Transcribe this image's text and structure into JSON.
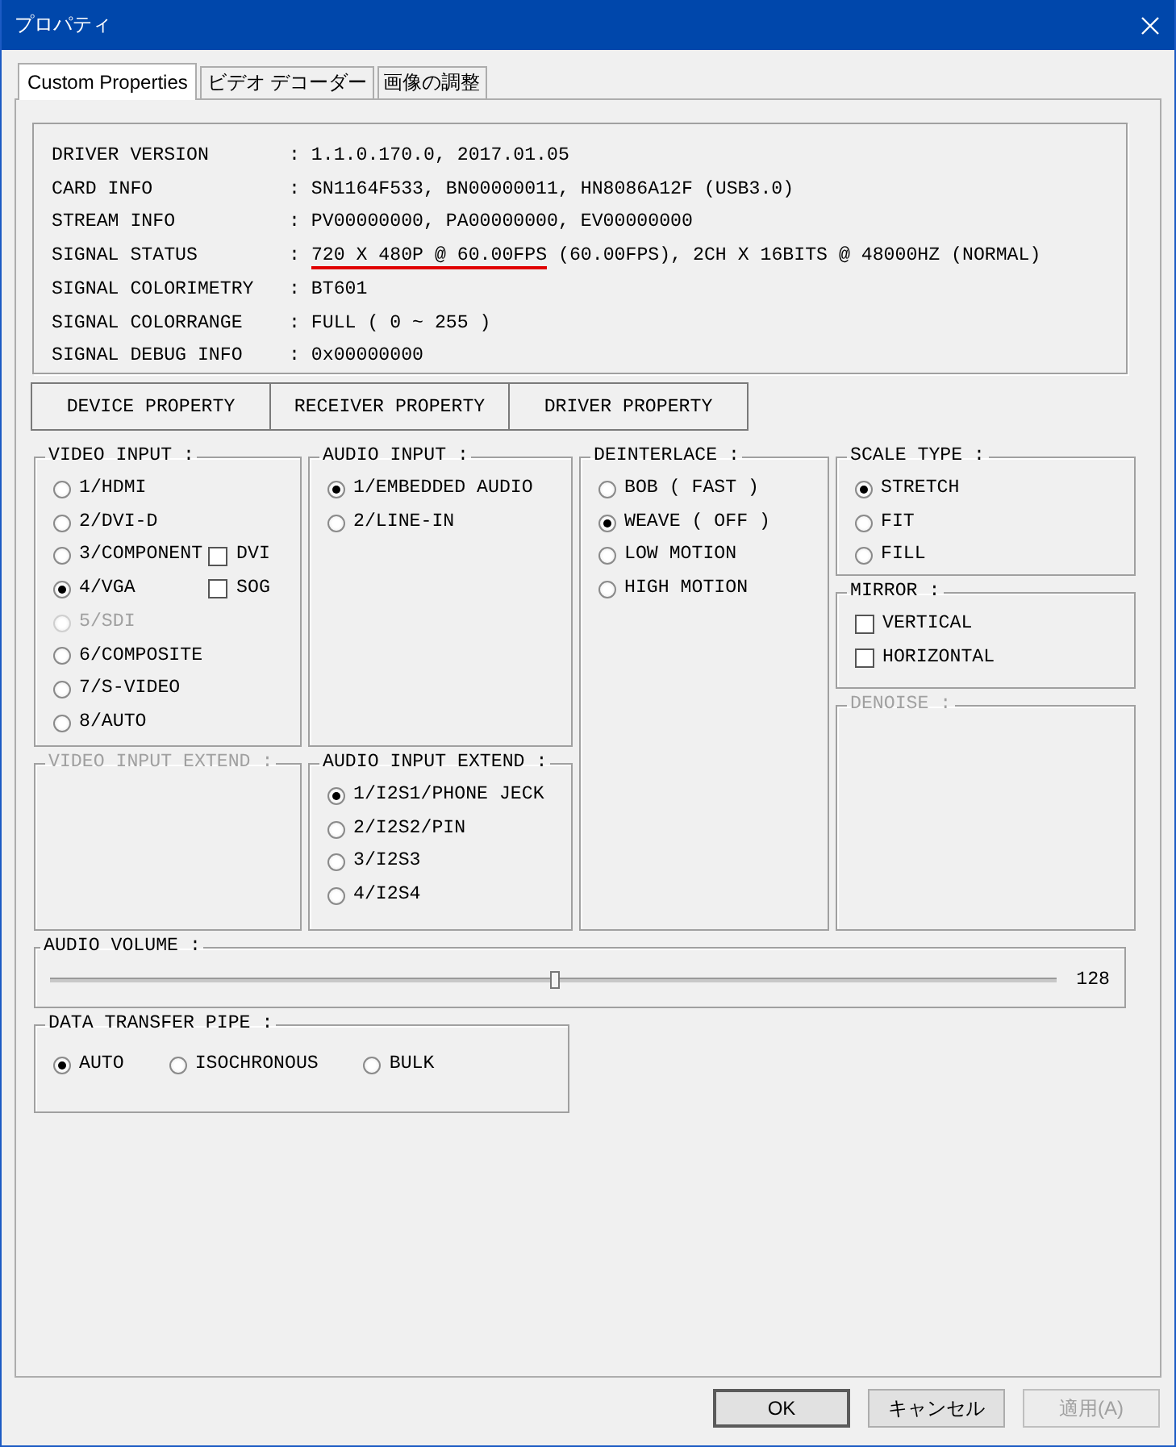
{
  "window": {
    "title": "プロパティ"
  },
  "tabs": [
    {
      "label": "Custom Properties",
      "selected": true
    },
    {
      "label": "ビデオ デコーダー",
      "selected": false
    },
    {
      "label": "画像の調整",
      "selected": false
    }
  ],
  "info_rows": [
    {
      "label": "DRIVER VERSION",
      "value": [
        {
          "text": ": 1.1.0.170.0, 2017.01.05",
          "underlined": false
        }
      ]
    },
    {
      "label": "CARD INFO",
      "value": [
        {
          "text": ": SN1164F533, BN00000011, HN8086A12F (USB3.0)",
          "underlined": false
        }
      ]
    },
    {
      "label": "STREAM INFO",
      "value": [
        {
          "text": ": PV00000000, PA00000000, EV00000000",
          "underlined": false
        }
      ]
    },
    {
      "label": "SIGNAL STATUS",
      "value": [
        {
          "text": ":",
          "underlined": false
        },
        {
          "text": "720 X 480P @ 60.00FPS",
          "underlined": true
        },
        {
          "text": "(60.00FPS), 2CH X 16BITS @ 48000HZ (NORMAL)",
          "underlined": false
        }
      ]
    },
    {
      "label": "SIGNAL COLORIMETRY",
      "value": [
        {
          "text": ": BT601",
          "underlined": false
        }
      ]
    },
    {
      "label": "SIGNAL COLORRANGE",
      "value": [
        {
          "text": ": FULL ( 0 ~ 255 )",
          "underlined": false
        }
      ]
    },
    {
      "label": "SIGNAL DEBUG INFO",
      "value": [
        {
          "text": ": 0x00000000",
          "underlined": false
        }
      ]
    }
  ],
  "property_buttons": [
    {
      "label": "DEVICE PROPERTY"
    },
    {
      "label": "RECEIVER PROPERTY"
    },
    {
      "label": "DRIVER PROPERTY"
    }
  ],
  "columns": [
    [
      {
        "title": "VIDEO INPUT :",
        "disabled": false,
        "options": [
          {
            "kind": "radio",
            "label": "1/HDMI",
            "selected": false,
            "disabled": false
          },
          {
            "kind": "radio",
            "label": "2/DVI-D",
            "selected": false,
            "disabled": false
          },
          {
            "kind": "radio",
            "label": "3/COMPONENT",
            "selected": false,
            "disabled": false,
            "extra": {
              "label": "DVI",
              "checked": false
            }
          },
          {
            "kind": "radio",
            "label": "4/VGA",
            "selected": true,
            "disabled": false,
            "extra": {
              "label": "SOG",
              "checked": false
            }
          },
          {
            "kind": "radio",
            "label": "5/SDI",
            "selected": false,
            "disabled": true
          },
          {
            "kind": "radio",
            "label": "6/COMPOSITE",
            "selected": false,
            "disabled": false
          },
          {
            "kind": "radio",
            "label": "7/S-VIDEO",
            "selected": false,
            "disabled": false
          },
          {
            "kind": "radio",
            "label": "8/AUTO",
            "selected": false,
            "disabled": false
          }
        ]
      },
      {
        "title": "VIDEO INPUT EXTEND :",
        "disabled": true
      }
    ],
    [
      {
        "title": "AUDIO INPUT :",
        "disabled": false,
        "options": [
          {
            "kind": "radio",
            "label": "1/EMBEDDED AUDIO",
            "selected": true,
            "disabled": false
          },
          {
            "kind": "radio",
            "label": "2/LINE-IN",
            "selected": false,
            "disabled": false
          }
        ]
      },
      {
        "title": "AUDIO INPUT EXTEND :",
        "disabled": false,
        "options": [
          {
            "kind": "radio",
            "label": "1/I2S1/PHONE JECK",
            "selected": true,
            "disabled": false
          },
          {
            "kind": "radio",
            "label": "2/I2S2/PIN",
            "selected": false,
            "disabled": false
          },
          {
            "kind": "radio",
            "label": "3/I2S3",
            "selected": false,
            "disabled": false
          },
          {
            "kind": "radio",
            "label": "4/I2S4",
            "selected": false,
            "disabled": false
          }
        ]
      }
    ],
    [
      {
        "title": "DEINTERLACE :",
        "disabled": false,
        "options": [
          {
            "kind": "radio",
            "label": "BOB ( FAST )",
            "selected": false,
            "disabled": false
          },
          {
            "kind": "radio",
            "label": "WEAVE ( OFF )",
            "selected": true,
            "disabled": false
          },
          {
            "kind": "radio",
            "label": "LOW MOTION",
            "selected": false,
            "disabled": false
          },
          {
            "kind": "radio",
            "label": "HIGH MOTION",
            "selected": false,
            "disabled": false
          }
        ]
      }
    ],
    [
      {
        "title": "SCALE TYPE :",
        "disabled": false,
        "options": [
          {
            "kind": "radio",
            "label": "STRETCH",
            "selected": true,
            "disabled": false
          },
          {
            "kind": "radio",
            "label": "FIT",
            "selected": false,
            "disabled": false
          },
          {
            "kind": "radio",
            "label": "FILL",
            "selected": false,
            "disabled": false
          }
        ]
      },
      {
        "title": "MIRROR :",
        "disabled": false,
        "options": [
          {
            "kind": "checkbox",
            "label": "VERTICAL",
            "checked": false,
            "disabled": false
          },
          {
            "kind": "checkbox",
            "label": "HORIZONTAL",
            "checked": false,
            "disabled": false
          }
        ]
      },
      {
        "title": "DENOISE :",
        "disabled": true
      }
    ]
  ],
  "audio_volume": {
    "title": "AUDIO VOLUME :",
    "level": 0.502,
    "reading": "128"
  },
  "data_transfer_pipe": {
    "title": "DATA TRANSFER PIPE :",
    "options": [
      {
        "label": "AUTO",
        "selected": true
      },
      {
        "label": "ISOCHRONOUS",
        "selected": false
      },
      {
        "label": "BULK",
        "selected": false
      }
    ]
  },
  "buttons": [
    {
      "label": "OK",
      "kind": "default",
      "disabled": false
    },
    {
      "label": "キャンセル",
      "kind": "normal",
      "disabled": false
    },
    {
      "label": "適用(A)",
      "kind": "normal",
      "disabled": true
    }
  ]
}
